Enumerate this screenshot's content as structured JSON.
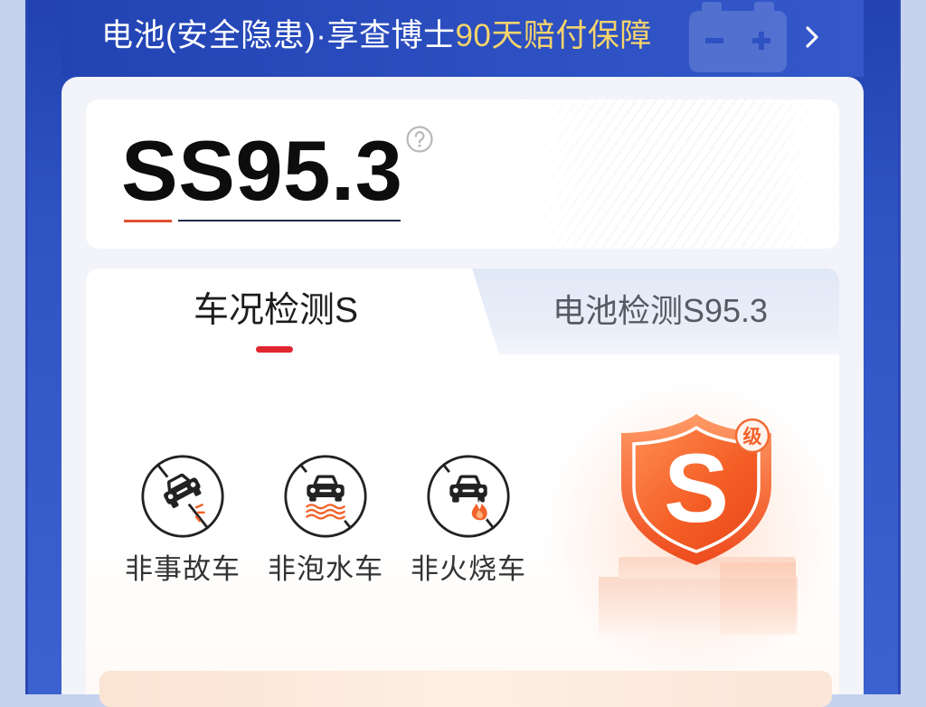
{
  "banner": {
    "text": "电池(安全隐患)·享查博士",
    "highlight": "90天赔付保障",
    "chevron_icon": "chevron-right-icon",
    "watermark_icon": "battery-icon"
  },
  "score": {
    "value": "SS95.3",
    "help_icon": "question-circle-icon"
  },
  "tabs": [
    {
      "label": "车况检测S",
      "active": true
    },
    {
      "label": "电池检测S95.3",
      "active": false
    }
  ],
  "checks": [
    {
      "label": "非事故车",
      "icon": "no-accident-car-icon"
    },
    {
      "label": "非泡水车",
      "icon": "no-flood-car-icon"
    },
    {
      "label": "非火烧车",
      "icon": "no-fire-car-icon"
    }
  ],
  "grade": {
    "letter": "S",
    "badge": "级",
    "icon": "grade-shield-icon"
  },
  "colors": {
    "frame_blue": "#2f52c2",
    "highlight_gold": "#f6d46b",
    "active_indicator": "#e0262e",
    "accent_orange": "#f2622a",
    "underline_red": "#e0522e",
    "underline_navy": "#1f2b48"
  }
}
